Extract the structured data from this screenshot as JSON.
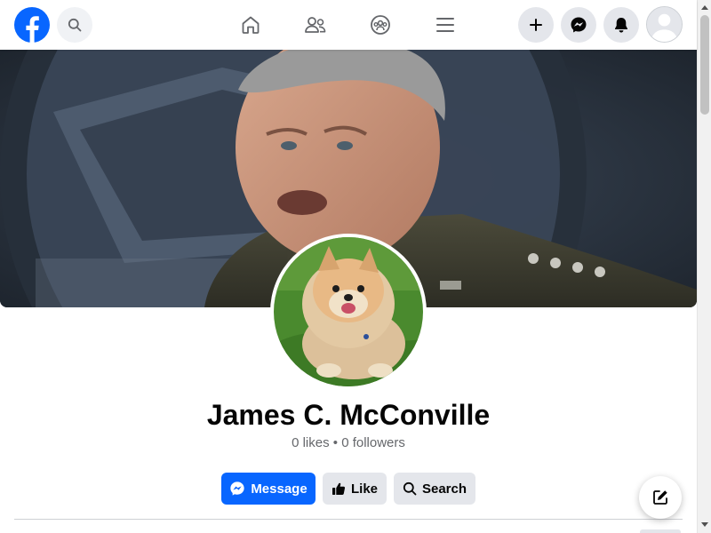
{
  "app": {
    "brand_color": "#0866ff"
  },
  "topbar": {
    "logo": "facebook-logo",
    "search_icon": "search-icon",
    "nav": [
      {
        "icon": "home-icon"
      },
      {
        "icon": "friends-icon"
      },
      {
        "icon": "groups-icon"
      },
      {
        "icon": "menu-icon"
      }
    ],
    "actions": [
      {
        "icon": "plus-icon"
      },
      {
        "icon": "messenger-icon"
      },
      {
        "icon": "bell-icon"
      },
      {
        "icon": "avatar"
      }
    ]
  },
  "cover": {
    "image": "cover-photo-portrait"
  },
  "profile": {
    "picture": "profile-photo-pomeranian",
    "name": "James C. McConville",
    "stats": "0 likes • 0 followers"
  },
  "buttons": {
    "message": "Message",
    "like": "Like",
    "search": "Search"
  },
  "fab": {
    "icon": "compose-icon"
  }
}
